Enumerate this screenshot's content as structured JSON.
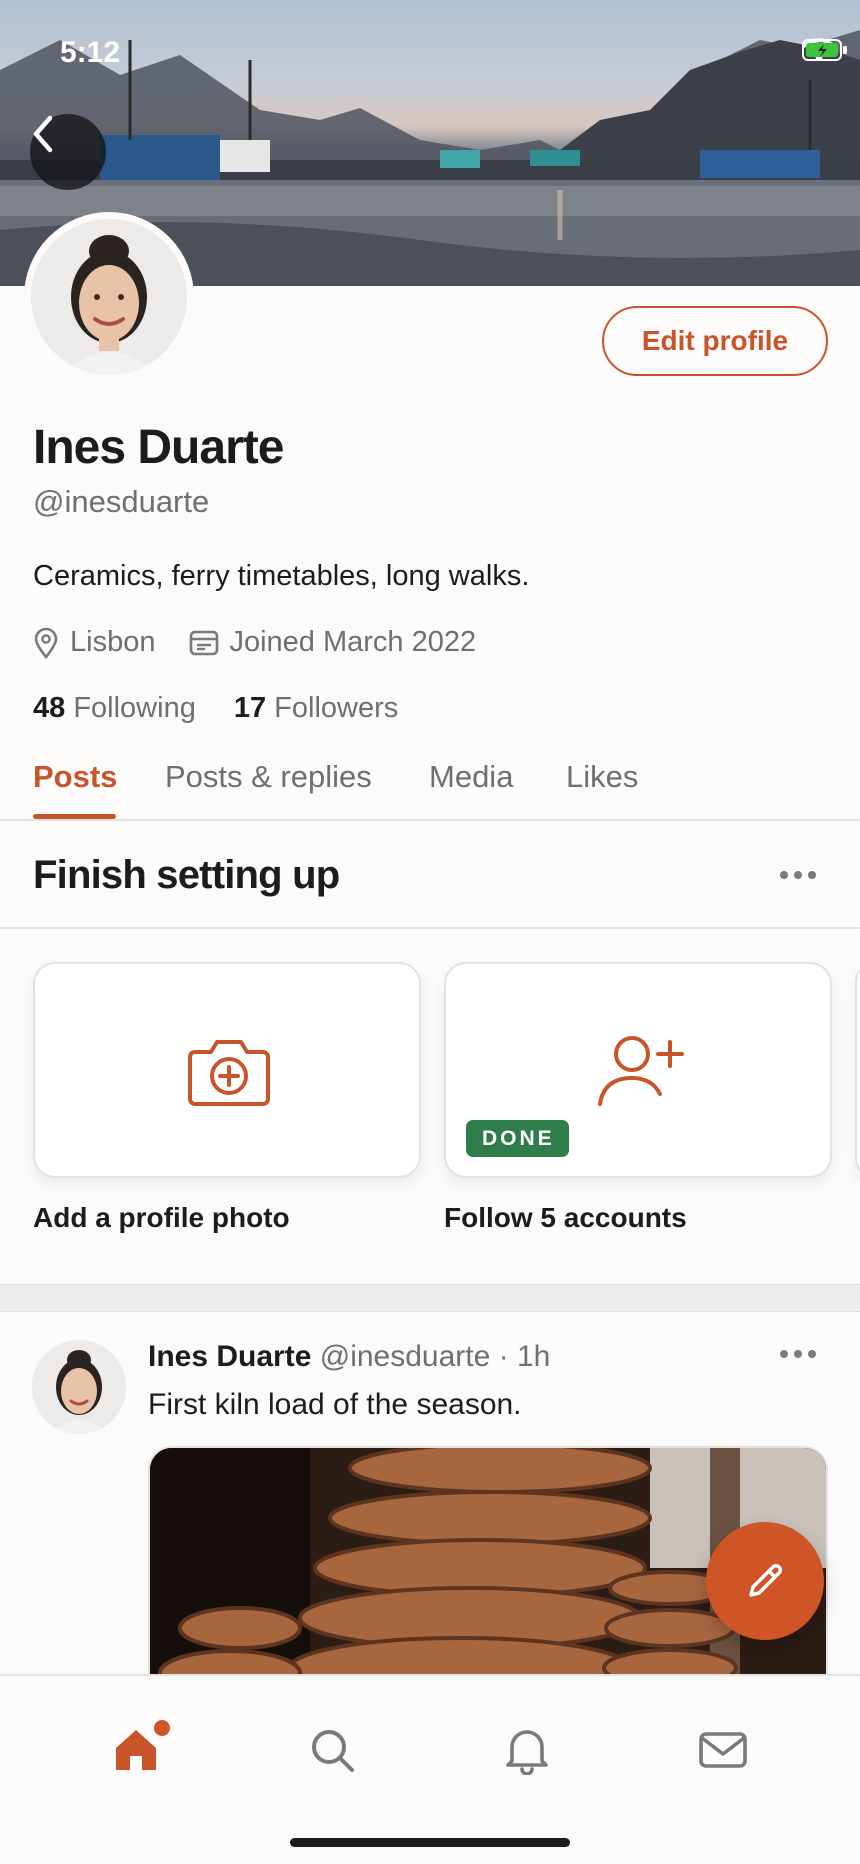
{
  "status_bar": {
    "time": "5:12"
  },
  "profile": {
    "name": "Ines Duarte",
    "handle": "@inesduarte",
    "bio": "Ceramics, ferry timetables, long walks.",
    "location": "Lisbon",
    "joined": "Joined March 2022",
    "following_count": "48",
    "following_label": "Following",
    "followers_count": "17",
    "followers_label": "Followers",
    "edit_label": "Edit profile"
  },
  "tabs": [
    {
      "label": "Posts",
      "active": true
    },
    {
      "label": "Posts & replies",
      "active": false
    },
    {
      "label": "Media",
      "active": false
    },
    {
      "label": "Likes",
      "active": false
    }
  ],
  "setup": {
    "title": "Finish setting up",
    "cards": [
      {
        "label": "Add a profile photo",
        "icon": "camera-plus-icon",
        "done": false
      },
      {
        "label": "Follow 5 accounts",
        "icon": "user-plus-icon",
        "done": true,
        "badge": "DONE"
      }
    ]
  },
  "post": {
    "author": "Ines Duarte",
    "handle": "@inesduarte",
    "separator": "·",
    "time": "1h",
    "text": "First kiln load of the season."
  },
  "bottom_nav": [
    "home-icon",
    "search-icon",
    "bell-icon",
    "mail-icon"
  ],
  "colors": {
    "accent": "#c8552a",
    "done_badge": "#2f7d4b",
    "background": "#fcfbfa"
  }
}
